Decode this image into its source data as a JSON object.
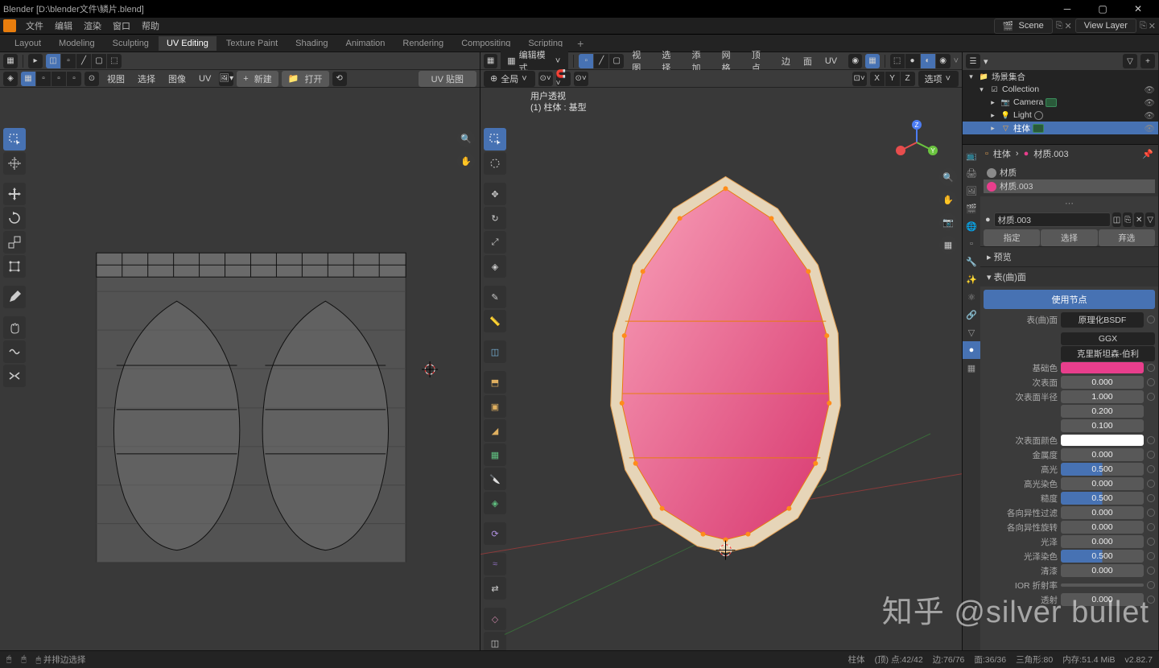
{
  "titlebar": {
    "title": "Blender  [D:\\blender文件\\鳞片.blend]"
  },
  "menubar": {
    "items": [
      "文件",
      "编辑",
      "渲染",
      "窗口",
      "帮助"
    ],
    "scene_icon": "scene-icon",
    "scene_label": "Scene",
    "layer_label": "View Layer"
  },
  "workspaces": {
    "items": [
      "Layout",
      "Modeling",
      "Sculpting",
      "UV Editing",
      "Texture Paint",
      "Shading",
      "Animation",
      "Rendering",
      "Compositing",
      "Scripting"
    ],
    "active_index": 3
  },
  "uv_editor": {
    "header": {
      "view": "视图",
      "select": "选择",
      "image": "图像",
      "uv": "UV",
      "new": "新建",
      "open": "打开"
    },
    "tag": "UV 贴图"
  },
  "viewport": {
    "mode_label": "编辑模式",
    "header": {
      "view": "视图",
      "select": "选择",
      "add": "添加",
      "mesh": "网格",
      "vertex": "顶点",
      "edge": "边",
      "face": "面",
      "uv": "UV",
      "global": "全局",
      "options": "选项"
    },
    "overlay": {
      "line1": "用户透视",
      "line2": "(1) 柱体 : 基型"
    }
  },
  "outliner": {
    "header_label": "场景集合",
    "rows": [
      {
        "indent": 0,
        "icon": "▾",
        "chk": "☑",
        "name": "Collection",
        "color": "#fff",
        "hl": false
      },
      {
        "indent": 1,
        "icon": "▸",
        "obj": "📷",
        "name": "Camera",
        "color": "#ea8f5c",
        "hl": false,
        "extra": "box"
      },
      {
        "indent": 1,
        "icon": "▸",
        "obj": "💡",
        "name": "Light",
        "color": "#6cc06c",
        "hl": false,
        "extra": "circle"
      },
      {
        "indent": 1,
        "icon": "▸",
        "obj": "▽",
        "name": "柱体",
        "color": "#f4a742",
        "hl": true,
        "extra": "mat"
      }
    ]
  },
  "properties": {
    "breadcrumb": {
      "obj": "柱体",
      "mat_icon": "●",
      "mat": "材质.003"
    },
    "slots": [
      {
        "name": "材质",
        "color": "#8a8a8a",
        "active": false
      },
      {
        "name": "材质.003",
        "color": "#e83e8c",
        "active": true
      }
    ],
    "mat_name": "材质.003",
    "assign": "指定",
    "select": "选择",
    "deselect": "弃选",
    "preview_label": "预览",
    "surface_label": "表(曲)面",
    "use_nodes": "使用节点",
    "surface_row": {
      "lbl": "表(曲)面",
      "val": "原理化BSDF"
    },
    "dist1": "GGX",
    "dist2": "克里斯坦森-伯利",
    "params": [
      {
        "lbl": "基础色",
        "type": "color",
        "val": "#e83e8c"
      },
      {
        "lbl": "次表面",
        "type": "num",
        "val": "0.000"
      },
      {
        "lbl": "次表面半径",
        "type": "vec",
        "vals": [
          "1.000",
          "0.200",
          "0.100"
        ]
      },
      {
        "lbl": "次表面颜色",
        "type": "color",
        "val": "#ffffff"
      },
      {
        "lbl": "金属度",
        "type": "num",
        "val": "0.000"
      },
      {
        "lbl": "高光",
        "type": "num",
        "val": "0.500",
        "blue": true
      },
      {
        "lbl": "高光染色",
        "type": "num",
        "val": "0.000"
      },
      {
        "lbl": "糙度",
        "type": "num",
        "val": "0.500",
        "blue": true
      },
      {
        "lbl": "各向异性过滤",
        "type": "num",
        "val": "0.000"
      },
      {
        "lbl": "各向异性旋转",
        "type": "num",
        "val": "0.000"
      },
      {
        "lbl": "光泽",
        "type": "num",
        "val": "0.000"
      },
      {
        "lbl": "光泽染色",
        "type": "num",
        "val": "0.500",
        "blue": true
      },
      {
        "lbl": "清漆",
        "type": "num",
        "val": "0.000"
      },
      {
        "lbl": "IOR 折射率",
        "type": "num",
        "val": ""
      },
      {
        "lbl": "透射",
        "type": "num",
        "val": "0.000"
      }
    ]
  },
  "statusbar": {
    "tip": "并排边选择",
    "obj": "柱体",
    "verts_lbl": "(顶) 点:",
    "verts": "42/42",
    "edges_lbl": "边:",
    "edges": "76/76",
    "faces_lbl": "面:",
    "faces": "36/36",
    "tris_lbl": "三角形:",
    "tris": "80",
    "mem_lbl": "内存:",
    "mem": "51.4 MiB",
    "ver": "v2.82.7"
  },
  "watermark": "知乎 @silver bullet"
}
